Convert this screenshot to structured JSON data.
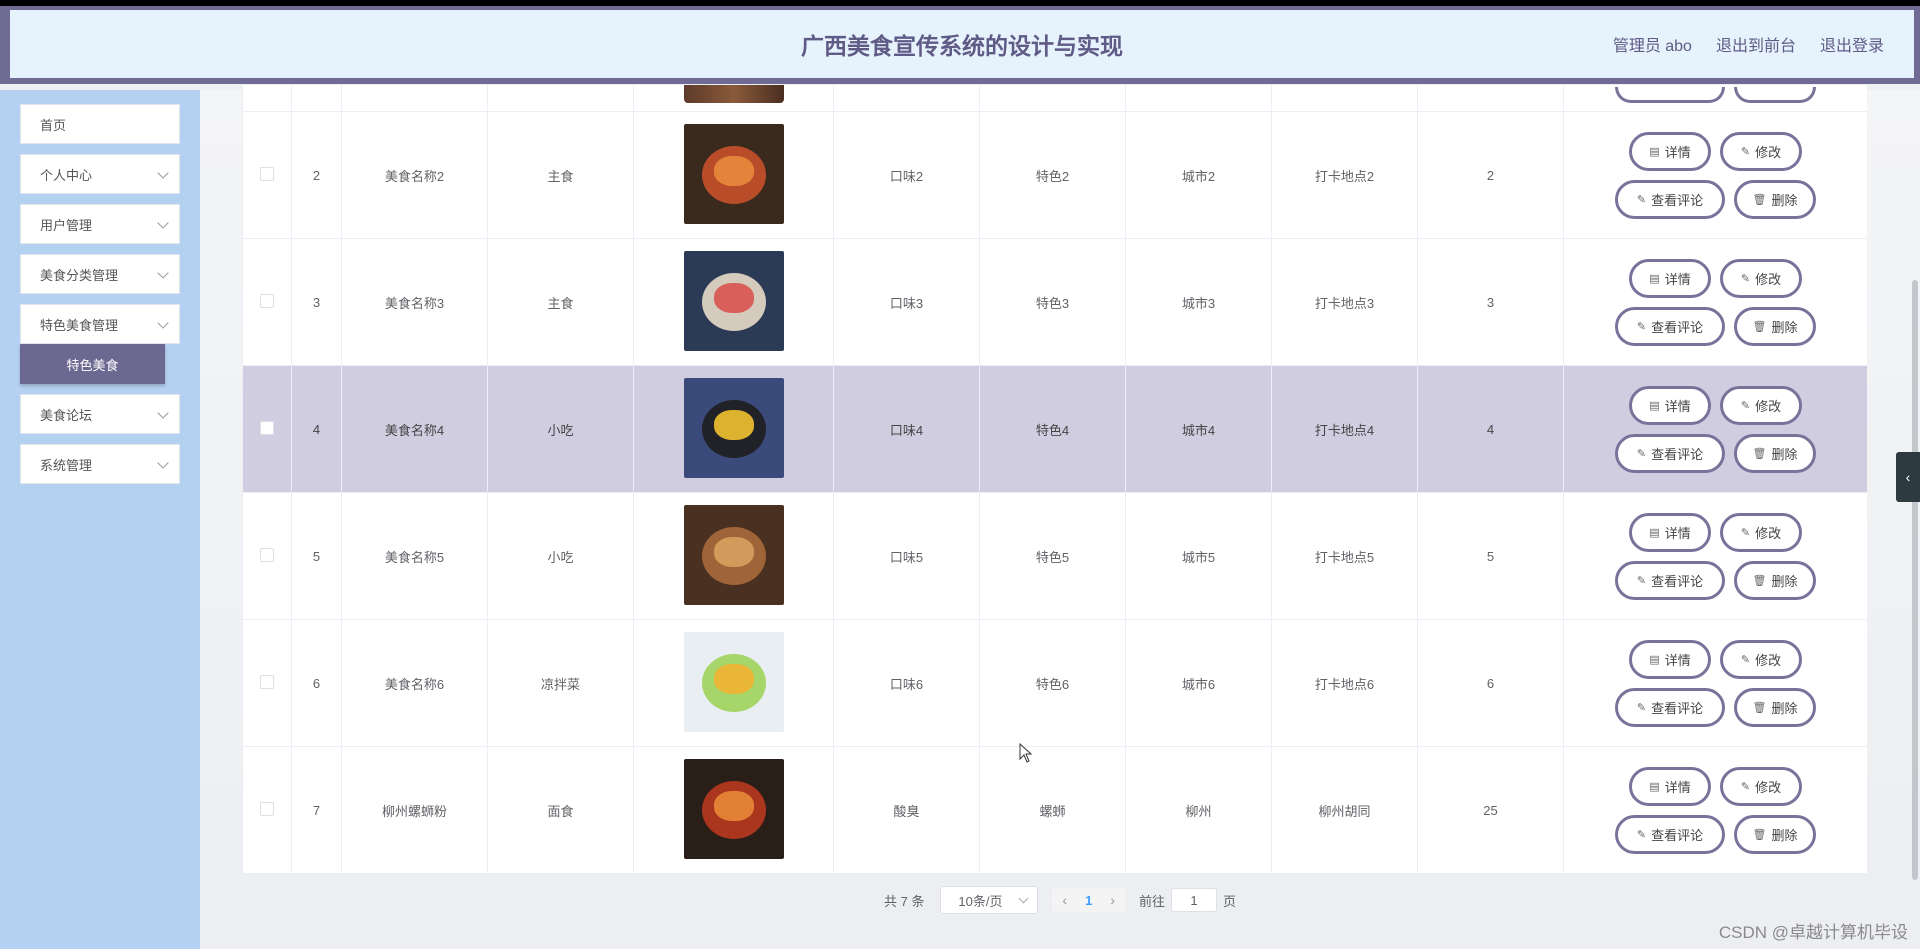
{
  "header": {
    "title": "广西美食宣传系统的设计与实现",
    "admin": "管理员 abo",
    "to_front": "退出到前台",
    "logout": "退出登录"
  },
  "sidebar": {
    "items": [
      {
        "label": "首页"
      },
      {
        "label": "个人中心"
      },
      {
        "label": "用户管理"
      },
      {
        "label": "美食分类管理"
      },
      {
        "label": "特色美食管理"
      },
      {
        "label": "美食论坛"
      },
      {
        "label": "系统管理"
      }
    ],
    "active_sub": "特色美食"
  },
  "table": {
    "rows": [
      {
        "index": "2",
        "name": "美食名称2",
        "category": "主食",
        "taste": "口味2",
        "feature": "特色2",
        "city": "城市2",
        "spot": "打卡地点2",
        "count": "2"
      },
      {
        "index": "3",
        "name": "美食名称3",
        "category": "主食",
        "taste": "口味3",
        "feature": "特色3",
        "city": "城市3",
        "spot": "打卡地点3",
        "count": "3"
      },
      {
        "index": "4",
        "name": "美食名称4",
        "category": "小吃",
        "taste": "口味4",
        "feature": "特色4",
        "city": "城市4",
        "spot": "打卡地点4",
        "count": "4"
      },
      {
        "index": "5",
        "name": "美食名称5",
        "category": "小吃",
        "taste": "口味5",
        "feature": "特色5",
        "city": "城市5",
        "spot": "打卡地点5",
        "count": "5"
      },
      {
        "index": "6",
        "name": "美食名称6",
        "category": "凉拌菜",
        "taste": "口味6",
        "feature": "特色6",
        "city": "城市6",
        "spot": "打卡地点6",
        "count": "6"
      },
      {
        "index": "7",
        "name": "柳州螺蛳粉",
        "category": "面食",
        "taste": "酸臭",
        "feature": "螺蛳",
        "city": "柳州",
        "spot": "柳州胡同",
        "count": "25"
      }
    ],
    "actions": {
      "detail": "详情",
      "edit": "修改",
      "comments": "查看评论",
      "delete": "删除"
    },
    "image_colors": [
      [
        "#3a2a1e",
        "#c8502a",
        "#e98a3c"
      ],
      [
        "#2b3a55",
        "#e7dcc8",
        "#d9534f"
      ],
      [
        "#3a4a7a",
        "#1e1e1e",
        "#f2c230"
      ],
      [
        "#4a3020",
        "#a86a3a",
        "#d8a060"
      ],
      [
        "#e9eef2",
        "#9fd35a",
        "#f2b233"
      ],
      [
        "#2a1e18",
        "#b83a1e",
        "#e88a3a"
      ]
    ]
  },
  "pager": {
    "total": "共 7 条",
    "page_size": "10条/页",
    "current": "1",
    "goto_label": "前往",
    "goto_value": "1",
    "page_unit": "页"
  },
  "watermark": "CSDN @卓越计算机毕设"
}
